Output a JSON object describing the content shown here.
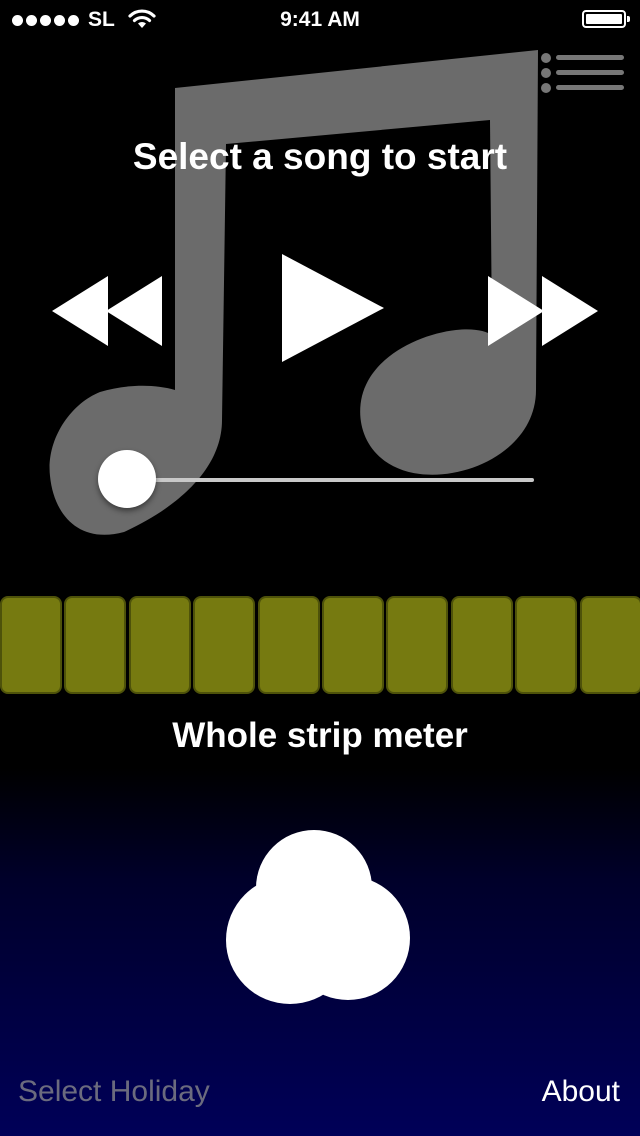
{
  "status_bar": {
    "carrier": "SL",
    "time": "9:41 AM"
  },
  "player": {
    "prompt": "Select a song to start",
    "progress": 0
  },
  "meter": {
    "label": "Whole strip meter",
    "cell_count": 10,
    "cell_color": "#767a10"
  },
  "footer": {
    "select_holiday_label": "Select Holiday",
    "about_label": "About"
  },
  "colors": {
    "background_top": "#000000",
    "background_bottom": "#000058",
    "note_art": "#6b6b6b",
    "disabled_text": "#6b6b7e"
  },
  "icons": [
    "music-note-icon",
    "menu-icon",
    "rewind-icon",
    "play-icon",
    "fast-forward-icon",
    "light-bulb-icon",
    "wifi-icon",
    "battery-icon"
  ]
}
